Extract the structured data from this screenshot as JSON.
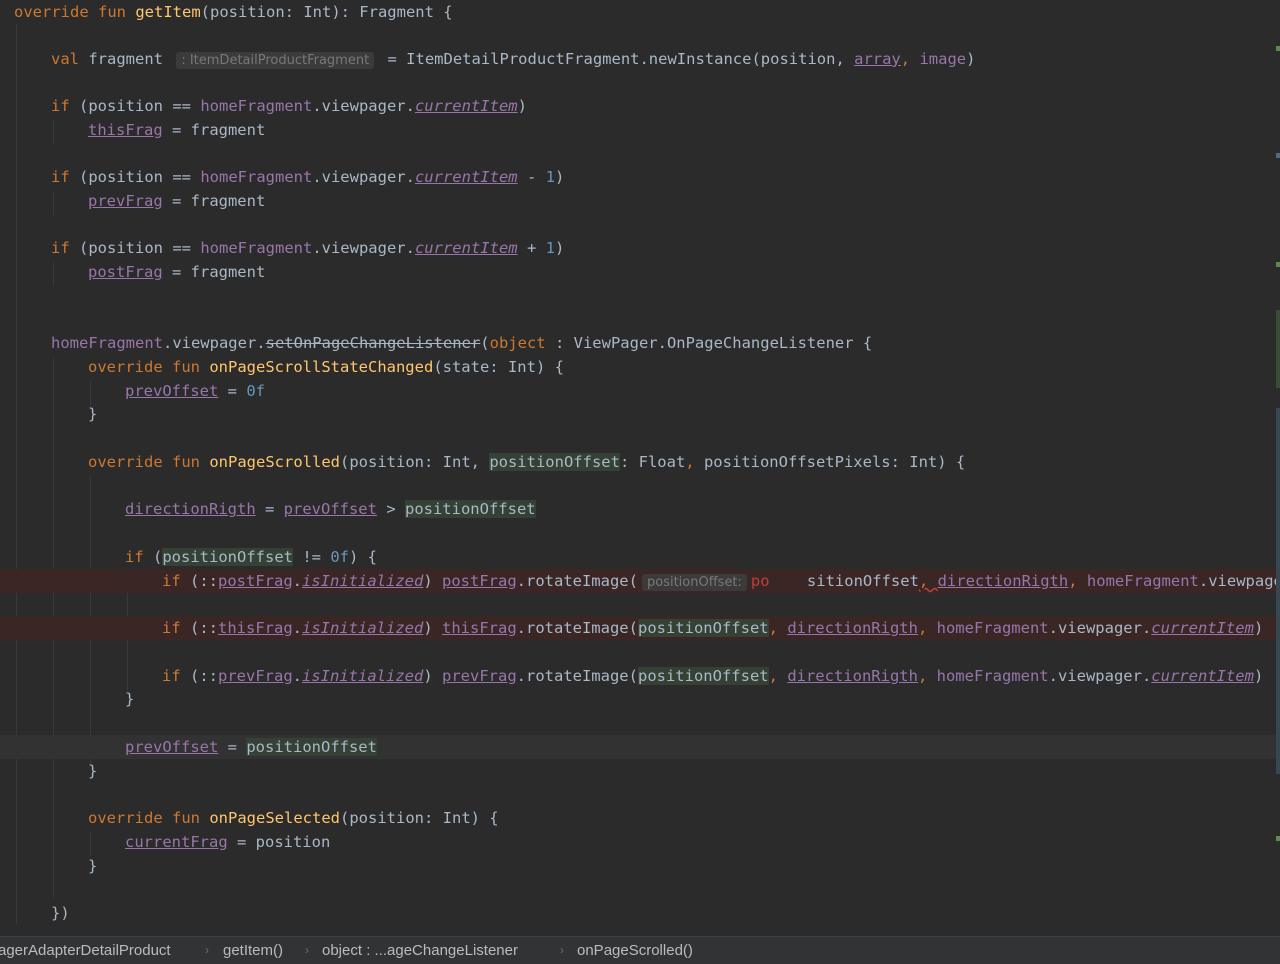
{
  "colors": {
    "background": "#2b2b2b",
    "keyword": "#cc7832",
    "function": "#ffc66d",
    "property": "#9876aa",
    "number": "#6897bb",
    "text": "#a9b7c6",
    "error_line": "#3b2626",
    "breadcrumb_bg": "#313335"
  },
  "code": {
    "l1": {
      "a": "override",
      "b": "fun",
      "c": "getItem",
      "d": "(position: Int): Fragment {"
    },
    "l2": {
      "a": "val",
      "b": " fragment ",
      "hint": ": ItemDetailProductFragment",
      "c": " = ItemDetailProductFragment.newInstance(position, ",
      "d": "array",
      "e": ", ",
      "f": "image",
      "g": ")"
    },
    "l3": {
      "a": "if",
      "b": " (position == ",
      "c": "homeFragment",
      "d": ".viewpager.",
      "e": "currentItem",
      "f": ")"
    },
    "l4": {
      "a": "thisFrag",
      "b": " = fragment"
    },
    "l5": {
      "a": "if",
      "b": " (position == ",
      "c": "homeFragment",
      "d": ".viewpager.",
      "e": "currentItem",
      "f": " - ",
      "g": "1",
      "h": ")"
    },
    "l6": {
      "a": "prevFrag",
      "b": " = fragment"
    },
    "l7": {
      "a": "if",
      "b": " (position == ",
      "c": "homeFragment",
      "d": ".viewpager.",
      "e": "currentItem",
      "f": " + ",
      "g": "1",
      "h": ")"
    },
    "l8": {
      "a": "postFrag",
      "b": " = fragment"
    },
    "l9": {
      "a": "homeFragment",
      "b": ".viewpager.",
      "c": "setOnPageChangeListener",
      "d": "(",
      "e": "object",
      "f": " : ViewPager.OnPageChangeListener {"
    },
    "l10": {
      "a": "override",
      "b": "fun",
      "c": "onPageScrollStateChanged",
      "d": "(state: Int) {"
    },
    "l11": {
      "a": "prevOffset",
      "b": " = ",
      "c": "0f"
    },
    "l12": {
      "a": "}"
    },
    "l13": {
      "a": "override",
      "b": "fun",
      "c": "onPageScrolled",
      "d": "(position: Int, ",
      "e": "positionOffset",
      "f": ": Float",
      "g": ", ",
      "h": "positionOffsetPixels: Int) {"
    },
    "l14": {
      "a": "directionRigth",
      "b": " = ",
      "c": "prevOffset",
      "d": " > ",
      "e": "positionOffset"
    },
    "l15": {
      "a": "if",
      "b": " (",
      "c": "positionOffset",
      "d": " != ",
      "e": "0f",
      "f": ") {"
    },
    "l16": {
      "a": "if",
      "b": " (::",
      "c": "postFrag",
      "d": ".",
      "e": "isInitialized",
      "f": ") ",
      "g": "postFrag",
      "h": ".rotateImage(",
      "hint": "positionOffset:",
      "i": "po",
      "j": "    sitionOffset",
      "k": ", ",
      "l": "directionRigth",
      "m": ", ",
      "n": "homeFragment",
      "o": ".viewpage"
    },
    "l17": {
      "a": "if",
      "b": " (::",
      "c": "thisFrag",
      "d": ".",
      "e": "isInitialized",
      "f": ") ",
      "g": "thisFrag",
      "h": ".rotateImage(",
      "i": "positionOffset",
      "j": ", ",
      "k": "directionRigth",
      "l": ", ",
      "m": "homeFragment",
      "n": ".viewpager.",
      "o": "currentItem",
      "p": ")"
    },
    "l18": {
      "a": "if",
      "b": " (::",
      "c": "prevFrag",
      "d": ".",
      "e": "isInitialized",
      "f": ") ",
      "g": "prevFrag",
      "h": ".rotateImage(",
      "i": "positionOffset",
      "j": ", ",
      "k": "directionRigth",
      "l": ", ",
      "m": "homeFragment",
      "n": ".viewpager.",
      "o": "currentItem",
      "p": ")"
    },
    "l19": {
      "a": "}"
    },
    "l20": {
      "a": "prevOffset",
      "b": " = ",
      "c": "positionOffset"
    },
    "l21": {
      "a": "}"
    },
    "l22": {
      "a": "override",
      "b": "fun",
      "c": "onPageSelected",
      "d": "(position: Int) {"
    },
    "l23": {
      "a": "currentFrag",
      "b": " = position"
    },
    "l24": {
      "a": "}"
    },
    "l25": {
      "a": "})"
    }
  },
  "breadcrumbs": [
    "agerAdapterDetailProduct",
    "getItem()",
    "object : ...ageChangeListener",
    "onPageScrolled()"
  ],
  "breadcrumb_separator": "›"
}
